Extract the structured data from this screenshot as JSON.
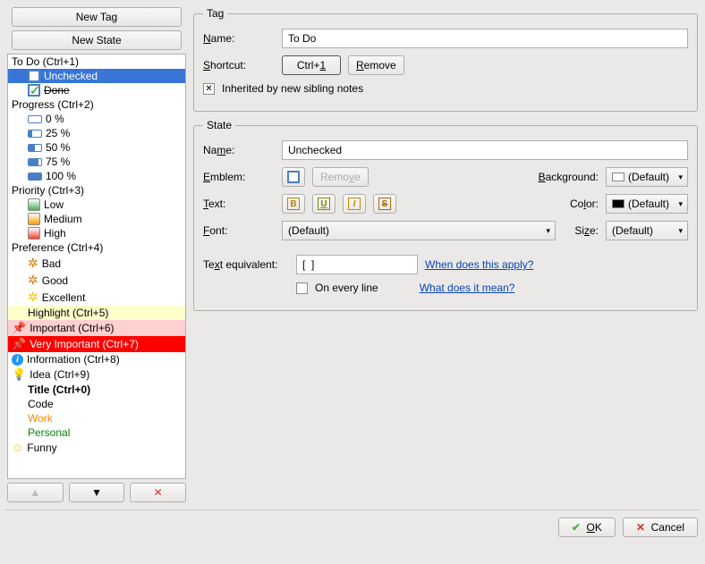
{
  "left": {
    "newTag": "New Tag",
    "newState": "New State",
    "tree": [
      {
        "t": "To Do (Ctrl+1)"
      },
      {
        "t": "Unchecked",
        "c": "ind1 sel",
        "i": "cbx"
      },
      {
        "t": "Done",
        "c": "ind1 done",
        "i": "cbc"
      },
      {
        "t": "Progress (Ctrl+2)"
      },
      {
        "t": "0 %",
        "c": "ind1",
        "i": "pbar",
        "p": 0
      },
      {
        "t": "25 %",
        "c": "ind1",
        "i": "pbar",
        "p": 25
      },
      {
        "t": "50 %",
        "c": "ind1",
        "i": "pbar",
        "p": 50
      },
      {
        "t": "75 %",
        "c": "ind1",
        "i": "pbar",
        "p": 75
      },
      {
        "t": "100 %",
        "c": "ind1",
        "i": "pbar",
        "p": 100
      },
      {
        "t": "Priority (Ctrl+3)"
      },
      {
        "t": "Low",
        "c": "ind1",
        "i": "pri lowp"
      },
      {
        "t": "Medium",
        "c": "ind1",
        "i": "pri medp"
      },
      {
        "t": "High",
        "c": "ind1",
        "i": "pri higp"
      },
      {
        "t": "Preference (Ctrl+4)"
      },
      {
        "t": "Bad",
        "c": "ind1",
        "i": "star"
      },
      {
        "t": "Good",
        "c": "ind1",
        "i": "star"
      },
      {
        "t": "Excellent",
        "c": "ind1",
        "i": "star gold"
      },
      {
        "t": "Highlight (Ctrl+5)",
        "c": "ind1 hl"
      },
      {
        "t": "Important (Ctrl+6)",
        "c": "imp",
        "i": "pin"
      },
      {
        "t": "Very Important (Ctrl+7)",
        "c": "vimp",
        "i": "pin"
      },
      {
        "t": "Information (Ctrl+8)",
        "i": "info"
      },
      {
        "t": "Idea (Ctrl+9)",
        "i": "bulb"
      },
      {
        "t": "Title (Ctrl+0)",
        "c": "ind1 bold"
      },
      {
        "t": "Code",
        "c": "ind1"
      },
      {
        "t": "Work",
        "c": "ind1 orange"
      },
      {
        "t": "Personal",
        "c": "ind1 green"
      },
      {
        "t": "Funny",
        "i": "smile"
      }
    ]
  },
  "tag": {
    "legend": "Tag",
    "nameL": "Name:",
    "name": "To Do",
    "shortL": "Shortcut:",
    "short": "Ctrl+1",
    "remove": "Remove",
    "inherit": "Inherited by new sibling notes"
  },
  "state": {
    "legend": "State",
    "nameL": "Name:",
    "name": "Unchecked",
    "embL": "Emblem:",
    "remove": "Remove",
    "bgL": "Background:",
    "bg": "(Default)",
    "textL": "Text:",
    "colorL": "Color:",
    "color": "(Default)",
    "fontL": "Font:",
    "font": "(Default)",
    "sizeL": "Size:",
    "size": "(Default)",
    "teqL": "Text equivalent:",
    "teq": "[  ]",
    "apply": "When does this apply?",
    "every": "On every line",
    "mean": "What does it mean?"
  },
  "footer": {
    "ok": "OK",
    "cancel": "Cancel"
  }
}
